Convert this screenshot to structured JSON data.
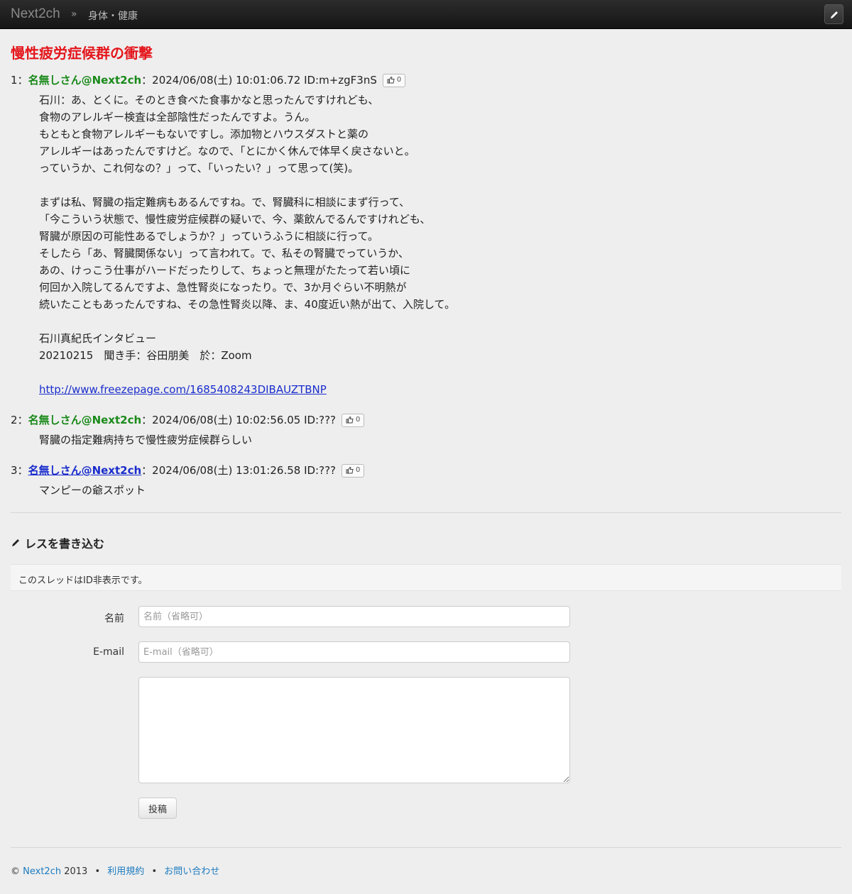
{
  "nav": {
    "brand": "Next2ch",
    "separator": "»",
    "category": "身体・健康",
    "edit_icon": "pencil-icon"
  },
  "thread": {
    "title": "慢性疲労症候群の衝撃"
  },
  "posts": [
    {
      "num": "1",
      "sep": "：",
      "name": "名無しさん@Next2ch",
      "meta": "：2024/06/08(土) 10:01:06.72 ID:m+zgF3nS",
      "likes": "0",
      "lines": [
        "石川：あ、とくに。そのとき食べた食事かなと思ったんですけれども、",
        "食物のアレルギー検査は全部陰性だったんですよ。うん。",
        "もともと食物アレルギーもないですし。添加物とハウスダストと薬の",
        "アレルギーはあったんですけど。なので、「とにかく休んで体早く戻さないと。",
        "っていうか、これ何なの？」って、「いったい？」って思って(笑)。",
        "",
        "まずは私、腎臓の指定難病もあるんですね。で、腎臓科に相談にまず行って、",
        "「今こういう状態で、慢性疲労症候群の疑いで、今、薬飲んでるんですけれども、",
        "腎臓が原因の可能性あるでしょうか？」っていうふうに相談に行って。",
        "そしたら「あ、腎臓関係ない」って言われて。で、私その腎臓でっていうか、",
        "あの、けっこう仕事がハードだったりして、ちょっと無理がたたって若い頃に",
        "何回か入院してるんですよ、急性腎炎になったり。で、3か月ぐらい不明熱が",
        "続いたこともあったんですね、その急性腎炎以降、ま、40度近い熱が出て、入院して。",
        "",
        "石川真紀氏インタビュー",
        "20210215　聞き手：谷田朋美　於：Zoom",
        ""
      ],
      "link": "http://www.freezepage.com/1685408243DIBAUZTBNP"
    },
    {
      "num": "2",
      "sep": "：",
      "name": "名無しさん@Next2ch",
      "meta": "：2024/06/08(土) 10:02:56.05 ID:???",
      "likes": "0",
      "lines": [
        "腎臓の指定難病持ちで慢性疲労症候群らしい"
      ]
    },
    {
      "num": "3",
      "sep": "：",
      "name": "名無しさん@Next2ch",
      "meta": "：2024/06/08(土) 13:01:26.58 ID:???",
      "likes": "0",
      "lines": [
        "マンピーの爺スポット"
      ]
    }
  ],
  "write": {
    "title": "レスを書き込む",
    "notice": "このスレッドはID非表示です。",
    "name_label": "名前",
    "name_placeholder": "名前（省略可）",
    "email_label": "E-mail",
    "email_placeholder": "E-mail（省略可）",
    "submit_label": "投稿"
  },
  "footer": {
    "copyright": "©",
    "brand_link": "Next2ch",
    "year": "2013",
    "dot": "•",
    "terms_link": "利用規約",
    "contact_link": "お問い合わせ"
  },
  "colors": {
    "title": "#e4151b",
    "poster_name": "#1a8a1a",
    "link": "#1a2dcc",
    "footer_link": "#1c7bbf",
    "navbar": "#1e1e1e",
    "background": "#eeeeee"
  }
}
